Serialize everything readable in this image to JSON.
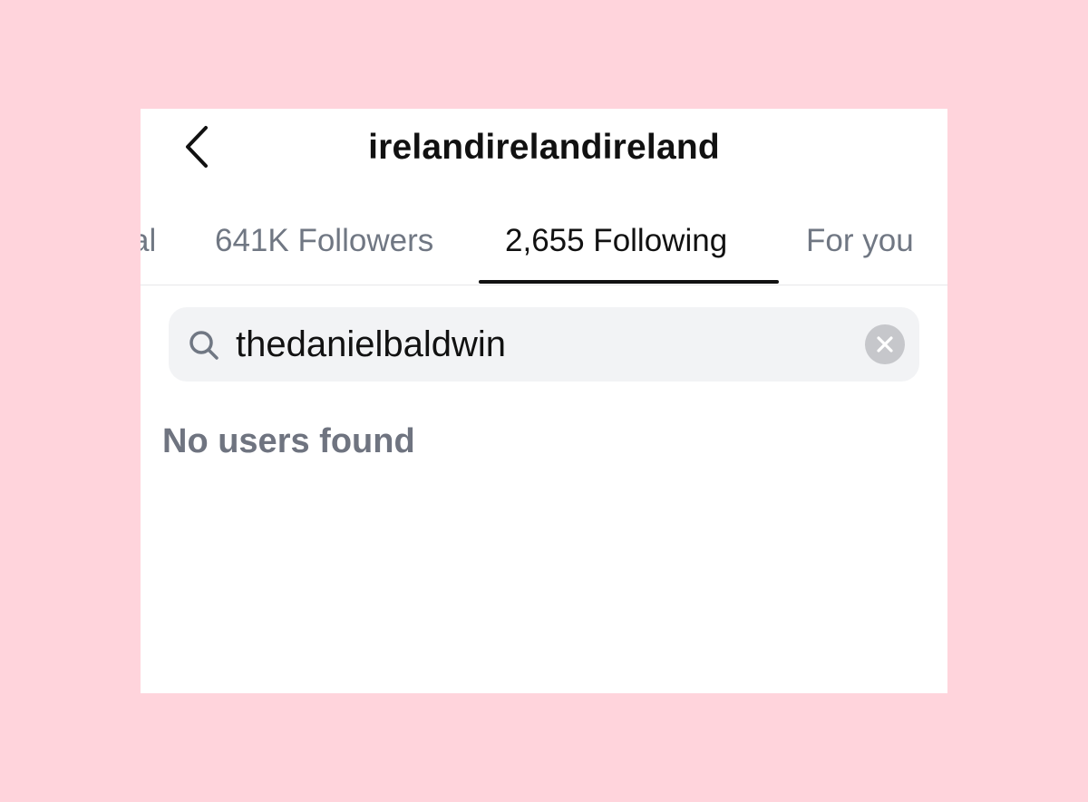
{
  "header": {
    "title": "irelandirelandireland"
  },
  "tabs": [
    {
      "label": "al",
      "active": false
    },
    {
      "label": "641K Followers",
      "active": false
    },
    {
      "label": "2,655 Following",
      "active": true
    },
    {
      "label": "For you",
      "active": false
    }
  ],
  "search": {
    "value": "thedanielbaldwin",
    "icon": "search-icon"
  },
  "results": {
    "empty_message": "No users found"
  },
  "colors": {
    "background": "#ffd4dc",
    "card": "#ffffff",
    "active_text": "#111111",
    "inactive_text": "#707783",
    "search_bg": "#f2f3f5",
    "clear_button": "#c6c7cb"
  }
}
